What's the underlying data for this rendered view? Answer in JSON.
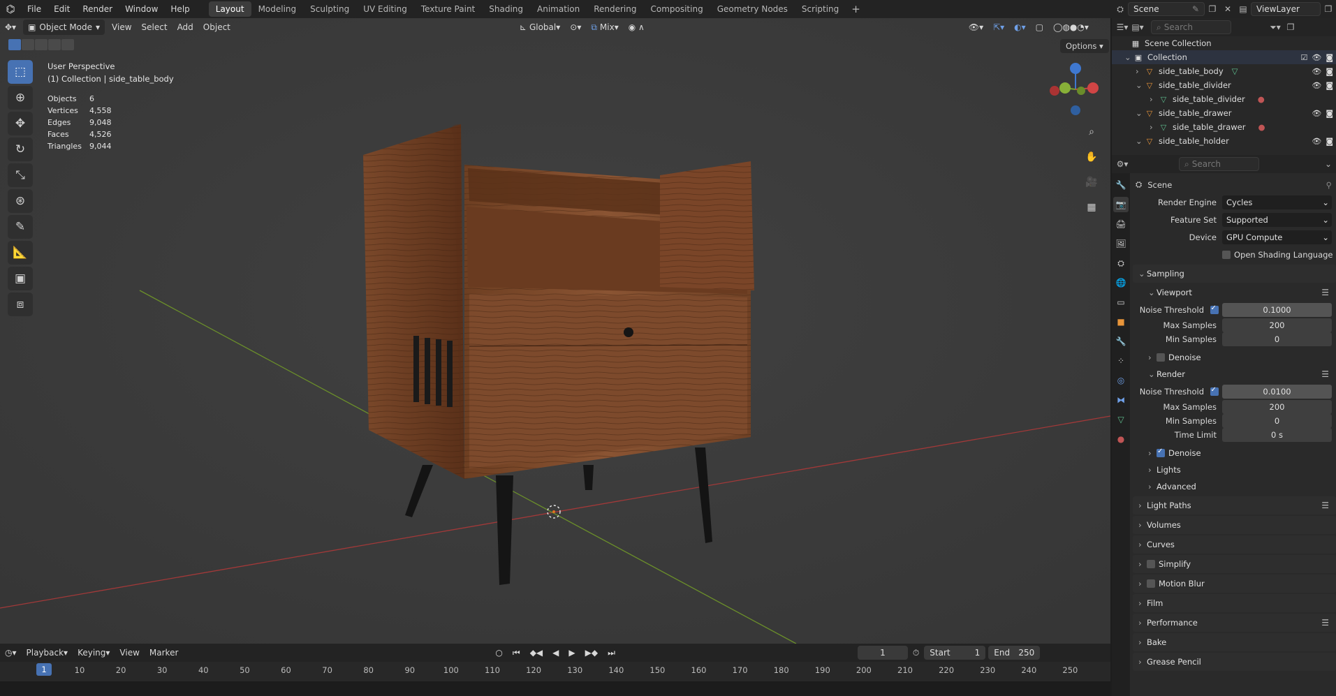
{
  "menu": [
    "File",
    "Edit",
    "Render",
    "Window",
    "Help"
  ],
  "workspaces": [
    "Layout",
    "Modeling",
    "Sculpting",
    "UV Editing",
    "Texture Paint",
    "Shading",
    "Animation",
    "Rendering",
    "Compositing",
    "Geometry Nodes",
    "Scripting"
  ],
  "scene_name": "Scene",
  "view_layer": "ViewLayer",
  "viewport": {
    "mode": "Object Mode",
    "menus": [
      "View",
      "Select",
      "Add",
      "Object"
    ],
    "orientation": "Global",
    "pivot": "Mix",
    "options": "Options",
    "perspective": "User Perspective",
    "collection_line": "(1) Collection | side_table_body",
    "stats": [
      {
        "k": "Objects",
        "v": "6"
      },
      {
        "k": "Vertices",
        "v": "4,558"
      },
      {
        "k": "Edges",
        "v": "9,048"
      },
      {
        "k": "Faces",
        "v": "4,526"
      },
      {
        "k": "Triangles",
        "v": "9,044"
      }
    ]
  },
  "outliner": {
    "search_placeholder": "Search",
    "root": "Scene Collection",
    "collection": "Collection",
    "items": [
      {
        "label": "side_table_body",
        "depth": 1
      },
      {
        "label": "side_table_divider",
        "depth": 1
      },
      {
        "label": "side_table_divider",
        "depth": 2
      },
      {
        "label": "side_table_drawer",
        "depth": 1
      },
      {
        "label": "side_table_drawer",
        "depth": 2
      },
      {
        "label": "side_table_holder",
        "depth": 1
      }
    ]
  },
  "properties": {
    "search_placeholder": "Search",
    "context": "Scene",
    "render_engine_label": "Render Engine",
    "render_engine": "Cycles",
    "feature_set_label": "Feature Set",
    "feature_set": "Supported",
    "device_label": "Device",
    "device": "GPU Compute",
    "osl": "Open Shading Language",
    "sampling": "Sampling",
    "viewport_sub": "Viewport",
    "noise_threshold_label": "Noise Threshold",
    "viewport_noise": "0.1000",
    "max_samples_label": "Max Samples",
    "viewport_max": "200",
    "min_samples_label": "Min Samples",
    "viewport_min": "0",
    "denoise": "Denoise",
    "render_sub": "Render",
    "render_noise": "0.0100",
    "render_max": "200",
    "render_min": "0",
    "time_limit_label": "Time Limit",
    "time_limit": "0 s",
    "lights": "Lights",
    "advanced": "Advanced",
    "light_paths": "Light Paths",
    "volumes": "Volumes",
    "curves": "Curves",
    "simplify": "Simplify",
    "motion_blur": "Motion Blur",
    "film": "Film",
    "performance": "Performance",
    "bake": "Bake",
    "grease_pencil": "Grease Pencil"
  },
  "timeline": {
    "menus": [
      "Playback",
      "Keying",
      "View",
      "Marker"
    ],
    "current_frame": "1",
    "start_label": "Start",
    "start": "1",
    "end_label": "End",
    "end": "250",
    "ticks": [
      "10",
      "20",
      "30",
      "40",
      "50",
      "60",
      "70",
      "80",
      "90",
      "100",
      "110",
      "120",
      "130",
      "140",
      "150",
      "160",
      "170",
      "180",
      "190",
      "200",
      "210",
      "220",
      "230",
      "240",
      "250"
    ]
  },
  "colors": {
    "accent": "#4772b3",
    "wood": "#7a4a2e",
    "x_axis": "#b03c3c",
    "y_axis": "#6f9a2c"
  }
}
